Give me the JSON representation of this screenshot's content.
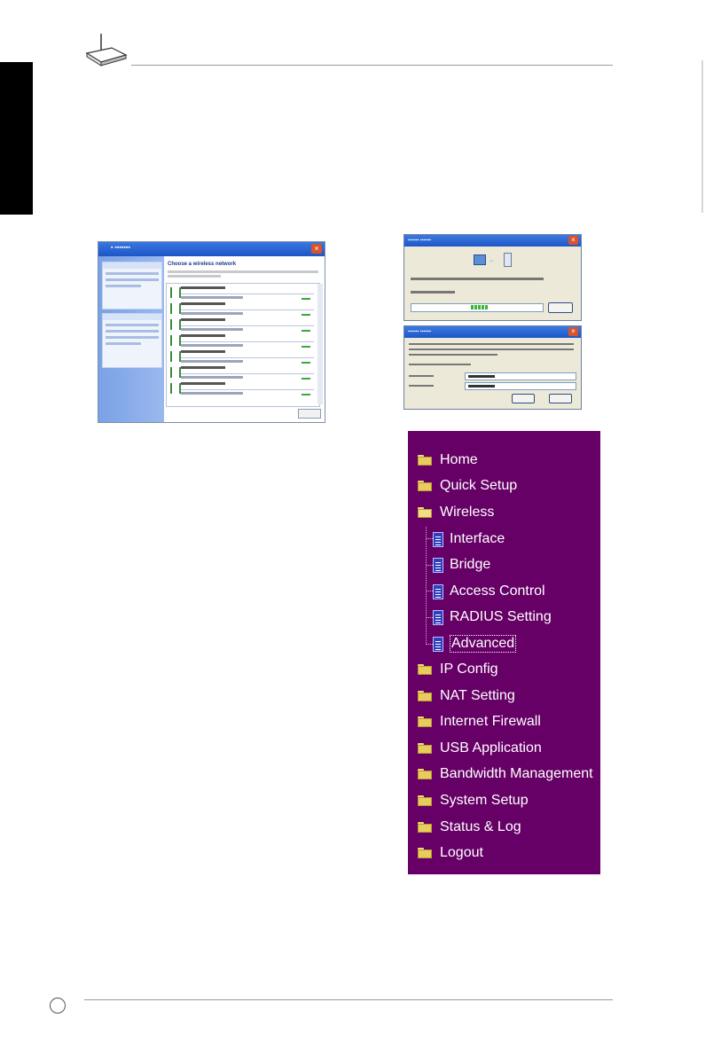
{
  "menu": {
    "background": "#660066",
    "items": [
      {
        "label": "Home",
        "icon": "folder-icon"
      },
      {
        "label": "Quick Setup",
        "icon": "folder-icon"
      },
      {
        "label": "Wireless",
        "icon": "folder-open-icon"
      },
      {
        "label": "Interface",
        "icon": "page-icon"
      },
      {
        "label": "Bridge",
        "icon": "page-icon"
      },
      {
        "label": "Access Control",
        "icon": "page-icon"
      },
      {
        "label": "RADIUS Setting",
        "icon": "page-icon"
      },
      {
        "label": "Advanced",
        "icon": "page-icon",
        "selected": true
      },
      {
        "label": "IP Config",
        "icon": "folder-icon"
      },
      {
        "label": "NAT Setting",
        "icon": "folder-icon"
      },
      {
        "label": "Internet Firewall",
        "icon": "folder-icon"
      },
      {
        "label": "USB Application",
        "icon": "folder-icon"
      },
      {
        "label": "Bandwidth Management",
        "icon": "folder-icon"
      },
      {
        "label": "System Setup",
        "icon": "folder-icon"
      },
      {
        "label": "Status & Log",
        "icon": "folder-icon"
      },
      {
        "label": "Logout",
        "icon": "folder-icon"
      }
    ]
  },
  "screenshots": {
    "choose_network_heading": "Choose a wireless network"
  }
}
